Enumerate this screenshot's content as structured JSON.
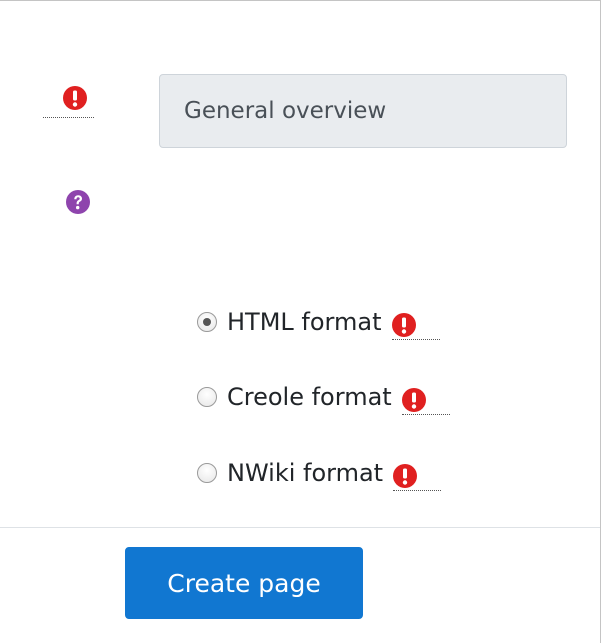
{
  "form": {
    "title_field": {
      "value": "General overview",
      "required_icon": "exclamation-circle-icon"
    },
    "help_icon": "question-circle-icon",
    "format_options": [
      {
        "label": "HTML format",
        "checked": true,
        "required_icon": "exclamation-circle-icon"
      },
      {
        "label": "Creole format",
        "checked": false,
        "required_icon": "exclamation-circle-icon"
      },
      {
        "label": "NWiki format",
        "checked": false,
        "required_icon": "exclamation-circle-icon"
      }
    ],
    "submit_label": "Create page"
  },
  "colors": {
    "required": "#e02020",
    "help": "#8e44ad",
    "primary_button": "#1177d1",
    "input_background": "#e9ecef"
  }
}
